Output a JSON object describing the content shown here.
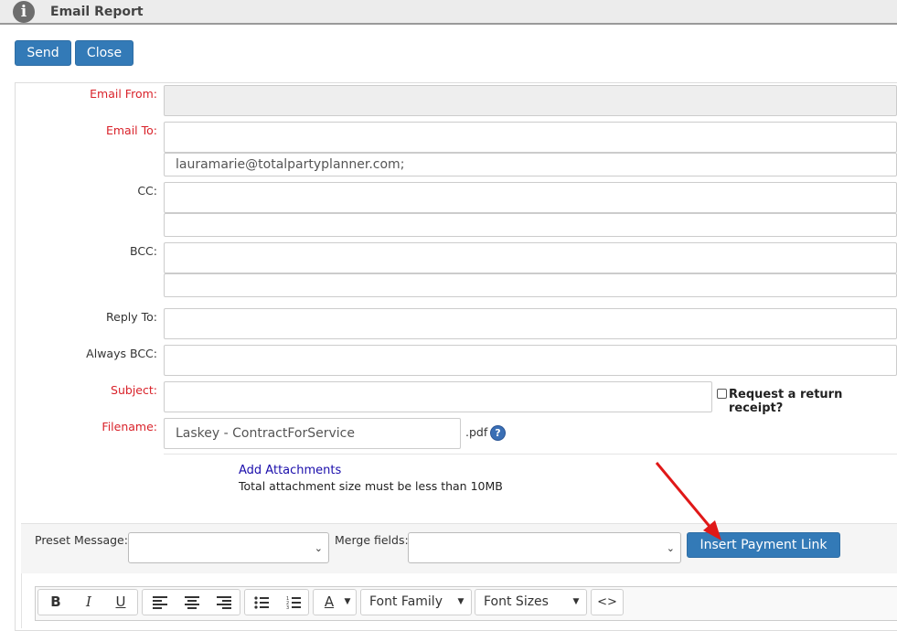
{
  "window": {
    "title": "Email Report"
  },
  "actions": {
    "send_label": "Send",
    "close_label": "Close"
  },
  "form": {
    "email_from": {
      "label": "Email From:",
      "value": ""
    },
    "email_to": {
      "label": "Email To:",
      "value": "",
      "selected_address": "lauramarie@totalpartyplanner.com;"
    },
    "cc": {
      "label": "CC:",
      "value": "",
      "extra": ""
    },
    "bcc": {
      "label": "BCC:",
      "value": "",
      "extra": ""
    },
    "reply_to": {
      "label": "Reply To:",
      "value": ""
    },
    "always_bcc": {
      "label": "Always BCC:",
      "value": ""
    },
    "subject": {
      "label": "Subject:",
      "value": ""
    },
    "return_receipt": {
      "label": "Request a return receipt?",
      "checked": false
    },
    "filename": {
      "label": "Filename:",
      "value": "Laskey - ContractForService",
      "extension": ".pdf"
    }
  },
  "attachments": {
    "link_label": "Add Attachments",
    "note": "Total attachment size must be less than 10MB"
  },
  "message_tools": {
    "preset_label": "Preset Message:",
    "preset_value": "",
    "merge_label": "Merge fields:",
    "merge_value": "",
    "payment_link_label": "Insert Payment Link"
  },
  "editor": {
    "font_family_label": "Font Family",
    "font_sizes_label": "Font Sizes",
    "bold_glyph": "B",
    "italic_glyph": "I",
    "underline_glyph": "U",
    "color_glyph": "A",
    "code_glyph": "<>"
  },
  "colors": {
    "primary": "#337ab7",
    "required_label": "#d9222a",
    "annotation_arrow": "#e01818"
  }
}
